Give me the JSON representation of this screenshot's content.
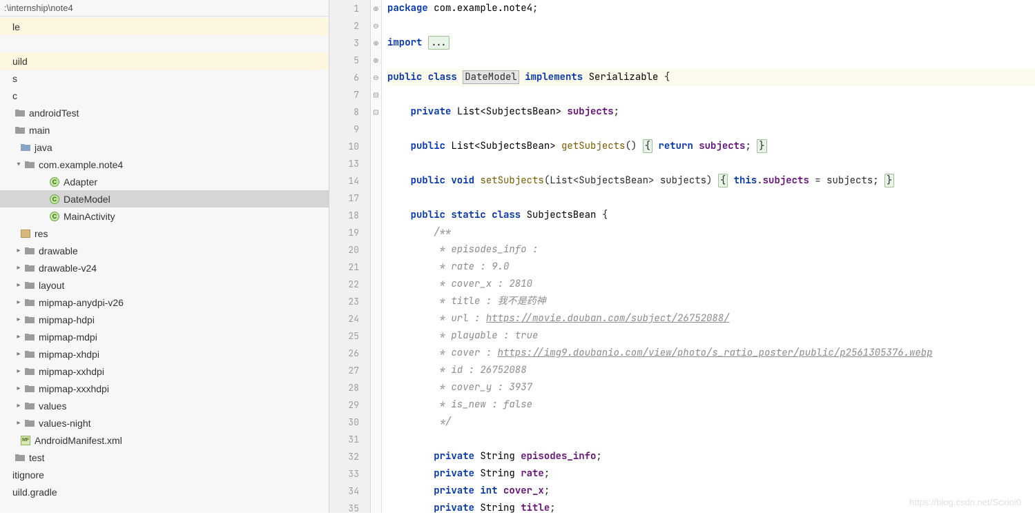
{
  "breadcrumb": ":\\internship\\note4",
  "tree": [
    {
      "indent": 0,
      "arrow": "",
      "icon": "",
      "label": "le",
      "hl": true
    },
    {
      "indent": 0,
      "arrow": "",
      "icon": "",
      "label": ""
    },
    {
      "indent": 0,
      "arrow": "",
      "icon": "",
      "label": "uild",
      "hl": true
    },
    {
      "indent": 0,
      "arrow": "",
      "icon": "",
      "label": "s"
    },
    {
      "indent": 0,
      "arrow": "",
      "icon": "",
      "label": "c"
    },
    {
      "indent": 2,
      "arrow": "",
      "icon": "folder",
      "label": "androidTest"
    },
    {
      "indent": 2,
      "arrow": "",
      "icon": "folder",
      "label": "main"
    },
    {
      "indent": 10,
      "arrow": "",
      "icon": "folder-open",
      "label": "java"
    },
    {
      "indent": 16,
      "arrow": "▾",
      "icon": "folder",
      "label": "com.example.note4"
    },
    {
      "indent": 52,
      "arrow": "",
      "icon": "class",
      "label": "Adapter"
    },
    {
      "indent": 52,
      "arrow": "",
      "icon": "class",
      "label": "DateModel",
      "selected": true
    },
    {
      "indent": 52,
      "arrow": "",
      "icon": "class",
      "label": "MainActivity"
    },
    {
      "indent": 10,
      "arrow": "",
      "icon": "resfolder",
      "label": "res"
    },
    {
      "indent": 16,
      "arrow": "▸",
      "icon": "folder",
      "label": "drawable"
    },
    {
      "indent": 16,
      "arrow": "▸",
      "icon": "folder",
      "label": "drawable-v24"
    },
    {
      "indent": 16,
      "arrow": "▸",
      "icon": "folder",
      "label": "layout"
    },
    {
      "indent": 16,
      "arrow": "▸",
      "icon": "folder",
      "label": "mipmap-anydpi-v26"
    },
    {
      "indent": 16,
      "arrow": "▸",
      "icon": "folder",
      "label": "mipmap-hdpi"
    },
    {
      "indent": 16,
      "arrow": "▸",
      "icon": "folder",
      "label": "mipmap-mdpi"
    },
    {
      "indent": 16,
      "arrow": "▸",
      "icon": "folder",
      "label": "mipmap-xhdpi"
    },
    {
      "indent": 16,
      "arrow": "▸",
      "icon": "folder",
      "label": "mipmap-xxhdpi"
    },
    {
      "indent": 16,
      "arrow": "▸",
      "icon": "folder",
      "label": "mipmap-xxxhdpi"
    },
    {
      "indent": 16,
      "arrow": "▸",
      "icon": "folder",
      "label": "values"
    },
    {
      "indent": 16,
      "arrow": "▸",
      "icon": "folder",
      "label": "values-night"
    },
    {
      "indent": 10,
      "arrow": "",
      "icon": "xml",
      "label": "AndroidManifest.xml"
    },
    {
      "indent": 2,
      "arrow": "",
      "icon": "folder",
      "label": "test"
    },
    {
      "indent": 0,
      "arrow": "",
      "icon": "",
      "label": "itignore"
    },
    {
      "indent": 0,
      "arrow": "",
      "icon": "",
      "label": "uild.gradle"
    }
  ],
  "editor": {
    "lines": [
      {
        "n": 1,
        "fold": "",
        "tokens": [
          [
            "kw",
            "package "
          ],
          [
            "type",
            "com.example.note4"
          ],
          [
            "",
            ";"
          ]
        ]
      },
      {
        "n": 2,
        "fold": "",
        "tokens": []
      },
      {
        "n": 3,
        "fold": "⊕",
        "tokens": [
          [
            "kw",
            "import "
          ],
          [
            "box",
            "..."
          ]
        ]
      },
      {
        "n": 5,
        "fold": "",
        "tokens": []
      },
      {
        "n": 6,
        "fold": "⊖",
        "hl": true,
        "tokens": [
          [
            "kw",
            "public class "
          ],
          [
            "box-class",
            "DateModel"
          ],
          [
            "kw",
            " implements "
          ],
          [
            "type",
            "Serializable "
          ],
          [
            "",
            "{"
          ]
        ]
      },
      {
        "n": 7,
        "fold": "",
        "tokens": []
      },
      {
        "n": 8,
        "fold": "",
        "tokens": [
          [
            "",
            "    "
          ],
          [
            "kw",
            "private "
          ],
          [
            "type",
            "List<SubjectsBean> "
          ],
          [
            "field",
            "subjects"
          ],
          [
            "",
            ";"
          ]
        ]
      },
      {
        "n": 9,
        "fold": "",
        "tokens": []
      },
      {
        "n": 10,
        "fold": "⊕",
        "tokens": [
          [
            "",
            "    "
          ],
          [
            "kw",
            "public "
          ],
          [
            "type",
            "List<SubjectsBean> "
          ],
          [
            "fn",
            "getSubjects"
          ],
          [
            "",
            "() "
          ],
          [
            "box",
            "{"
          ],
          [
            "kw",
            " return "
          ],
          [
            "field",
            "subjects"
          ],
          [
            "",
            "; "
          ],
          [
            "box",
            "}"
          ]
        ]
      },
      {
        "n": 13,
        "fold": "",
        "tokens": []
      },
      {
        "n": 14,
        "fold": "⊕",
        "tokens": [
          [
            "",
            "    "
          ],
          [
            "kw",
            "public void "
          ],
          [
            "fn",
            "setSubjects"
          ],
          [
            "",
            "(List<SubjectsBean> subjects) "
          ],
          [
            "box",
            "{"
          ],
          [
            "kw",
            " this"
          ],
          [
            "",
            "."
          ],
          [
            "field",
            "subjects"
          ],
          [
            "",
            " = subjects; "
          ],
          [
            "box",
            "}"
          ]
        ]
      },
      {
        "n": 17,
        "fold": "",
        "tokens": []
      },
      {
        "n": 18,
        "fold": "⊖",
        "tokens": [
          [
            "",
            "    "
          ],
          [
            "kw",
            "public static class "
          ],
          [
            "type",
            "SubjectsBean "
          ],
          [
            "",
            "{"
          ]
        ]
      },
      {
        "n": 19,
        "fold": "⊟",
        "tokens": [
          [
            "",
            "        "
          ],
          [
            "cmt",
            "/**"
          ]
        ]
      },
      {
        "n": 20,
        "fold": "",
        "tokens": [
          [
            "",
            "        "
          ],
          [
            "cmt",
            " * episodes_info :"
          ]
        ]
      },
      {
        "n": 21,
        "fold": "",
        "tokens": [
          [
            "",
            "        "
          ],
          [
            "cmt",
            " * rate : 9.0"
          ]
        ]
      },
      {
        "n": 22,
        "fold": "",
        "tokens": [
          [
            "",
            "        "
          ],
          [
            "cmt",
            " * cover_x : 2810"
          ]
        ]
      },
      {
        "n": 23,
        "fold": "",
        "tokens": [
          [
            "",
            "        "
          ],
          [
            "cmt",
            " * title : 我不是药神"
          ]
        ]
      },
      {
        "n": 24,
        "fold": "",
        "tokens": [
          [
            "",
            "        "
          ],
          [
            "cmt",
            " * url : "
          ],
          [
            "url-cmt",
            "https://movie.douban.com/subject/26752088/"
          ]
        ]
      },
      {
        "n": 25,
        "fold": "",
        "tokens": [
          [
            "",
            "        "
          ],
          [
            "cmt",
            " * playable : true"
          ]
        ]
      },
      {
        "n": 26,
        "fold": "",
        "tokens": [
          [
            "",
            "        "
          ],
          [
            "cmt",
            " * cover : "
          ],
          [
            "url-cmt",
            "https://img9.doubanio.com/view/photo/s_ratio_poster/public/p2561305376.webp"
          ]
        ]
      },
      {
        "n": 27,
        "fold": "",
        "tokens": [
          [
            "",
            "        "
          ],
          [
            "cmt",
            " * id : 26752088"
          ]
        ]
      },
      {
        "n": 28,
        "fold": "",
        "tokens": [
          [
            "",
            "        "
          ],
          [
            "cmt",
            " * cover_y : 3937"
          ]
        ]
      },
      {
        "n": 29,
        "fold": "",
        "tokens": [
          [
            "",
            "        "
          ],
          [
            "cmt",
            " * is_new : false"
          ]
        ]
      },
      {
        "n": 30,
        "fold": "⊡",
        "tokens": [
          [
            "",
            "        "
          ],
          [
            "cmt",
            " */"
          ]
        ]
      },
      {
        "n": 31,
        "fold": "",
        "tokens": []
      },
      {
        "n": 32,
        "fold": "",
        "tokens": [
          [
            "",
            "        "
          ],
          [
            "kw",
            "private "
          ],
          [
            "type",
            "String "
          ],
          [
            "field",
            "episodes_info"
          ],
          [
            "",
            ";"
          ]
        ]
      },
      {
        "n": 33,
        "fold": "",
        "tokens": [
          [
            "",
            "        "
          ],
          [
            "kw",
            "private "
          ],
          [
            "type",
            "String "
          ],
          [
            "field",
            "rate"
          ],
          [
            "",
            ";"
          ]
        ]
      },
      {
        "n": 34,
        "fold": "",
        "tokens": [
          [
            "",
            "        "
          ],
          [
            "kw",
            "private int "
          ],
          [
            "field",
            "cover_x"
          ],
          [
            "",
            ";"
          ]
        ]
      },
      {
        "n": 35,
        "fold": "",
        "tokens": [
          [
            "",
            "        "
          ],
          [
            "kw",
            "private "
          ],
          [
            "type",
            "String "
          ],
          [
            "field",
            "title"
          ],
          [
            "",
            ";"
          ]
        ]
      }
    ]
  },
  "watermark": "https://blog.csdn.net/Scxioi0"
}
